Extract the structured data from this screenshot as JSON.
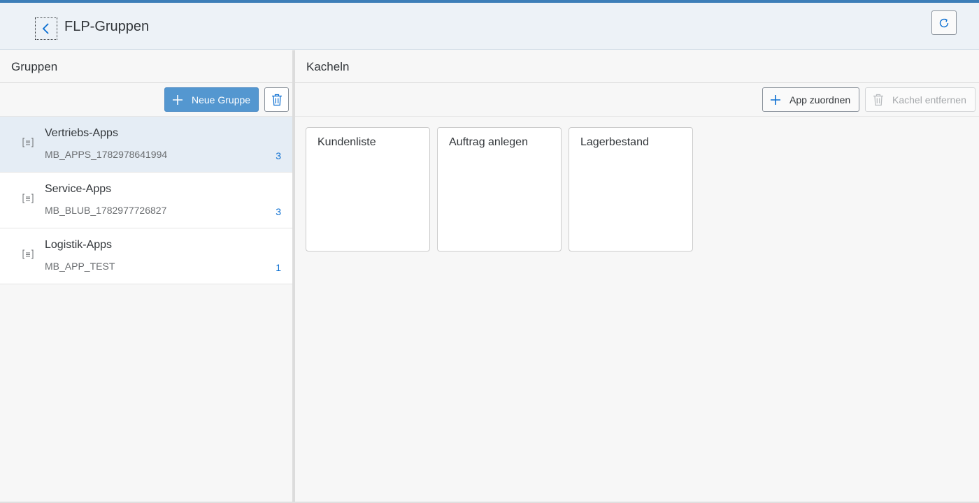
{
  "header": {
    "title": "FLP-Gruppen",
    "back_icon": "chevron-left-icon",
    "refresh_icon": "refresh-icon"
  },
  "left_pane": {
    "title": "Gruppen",
    "new_group_label": "Neue Gruppe",
    "groups": [
      {
        "title": "Vertriebs-Apps",
        "id": "MB_APPS_1782978641994",
        "count": "3",
        "selected": true
      },
      {
        "title": "Service-Apps",
        "id": "MB_BLUB_1782977726827",
        "count": "3",
        "selected": false
      },
      {
        "title": "Logistik-Apps",
        "id": "MB_APP_TEST",
        "count": "1",
        "selected": false
      }
    ]
  },
  "right_pane": {
    "title": "Kacheln",
    "assign_app_label": "App zuordnen",
    "remove_tile_label": "Kachel entfernen",
    "tiles": [
      {
        "title": "Kundenliste"
      },
      {
        "title": "Auftrag anlegen"
      },
      {
        "title": "Lagerbestand"
      }
    ]
  },
  "colors": {
    "accent": "#3d7eb8",
    "primary_button": "#5497d0",
    "count_text": "#0a6ed1",
    "selected_row": "#e5edf5"
  }
}
